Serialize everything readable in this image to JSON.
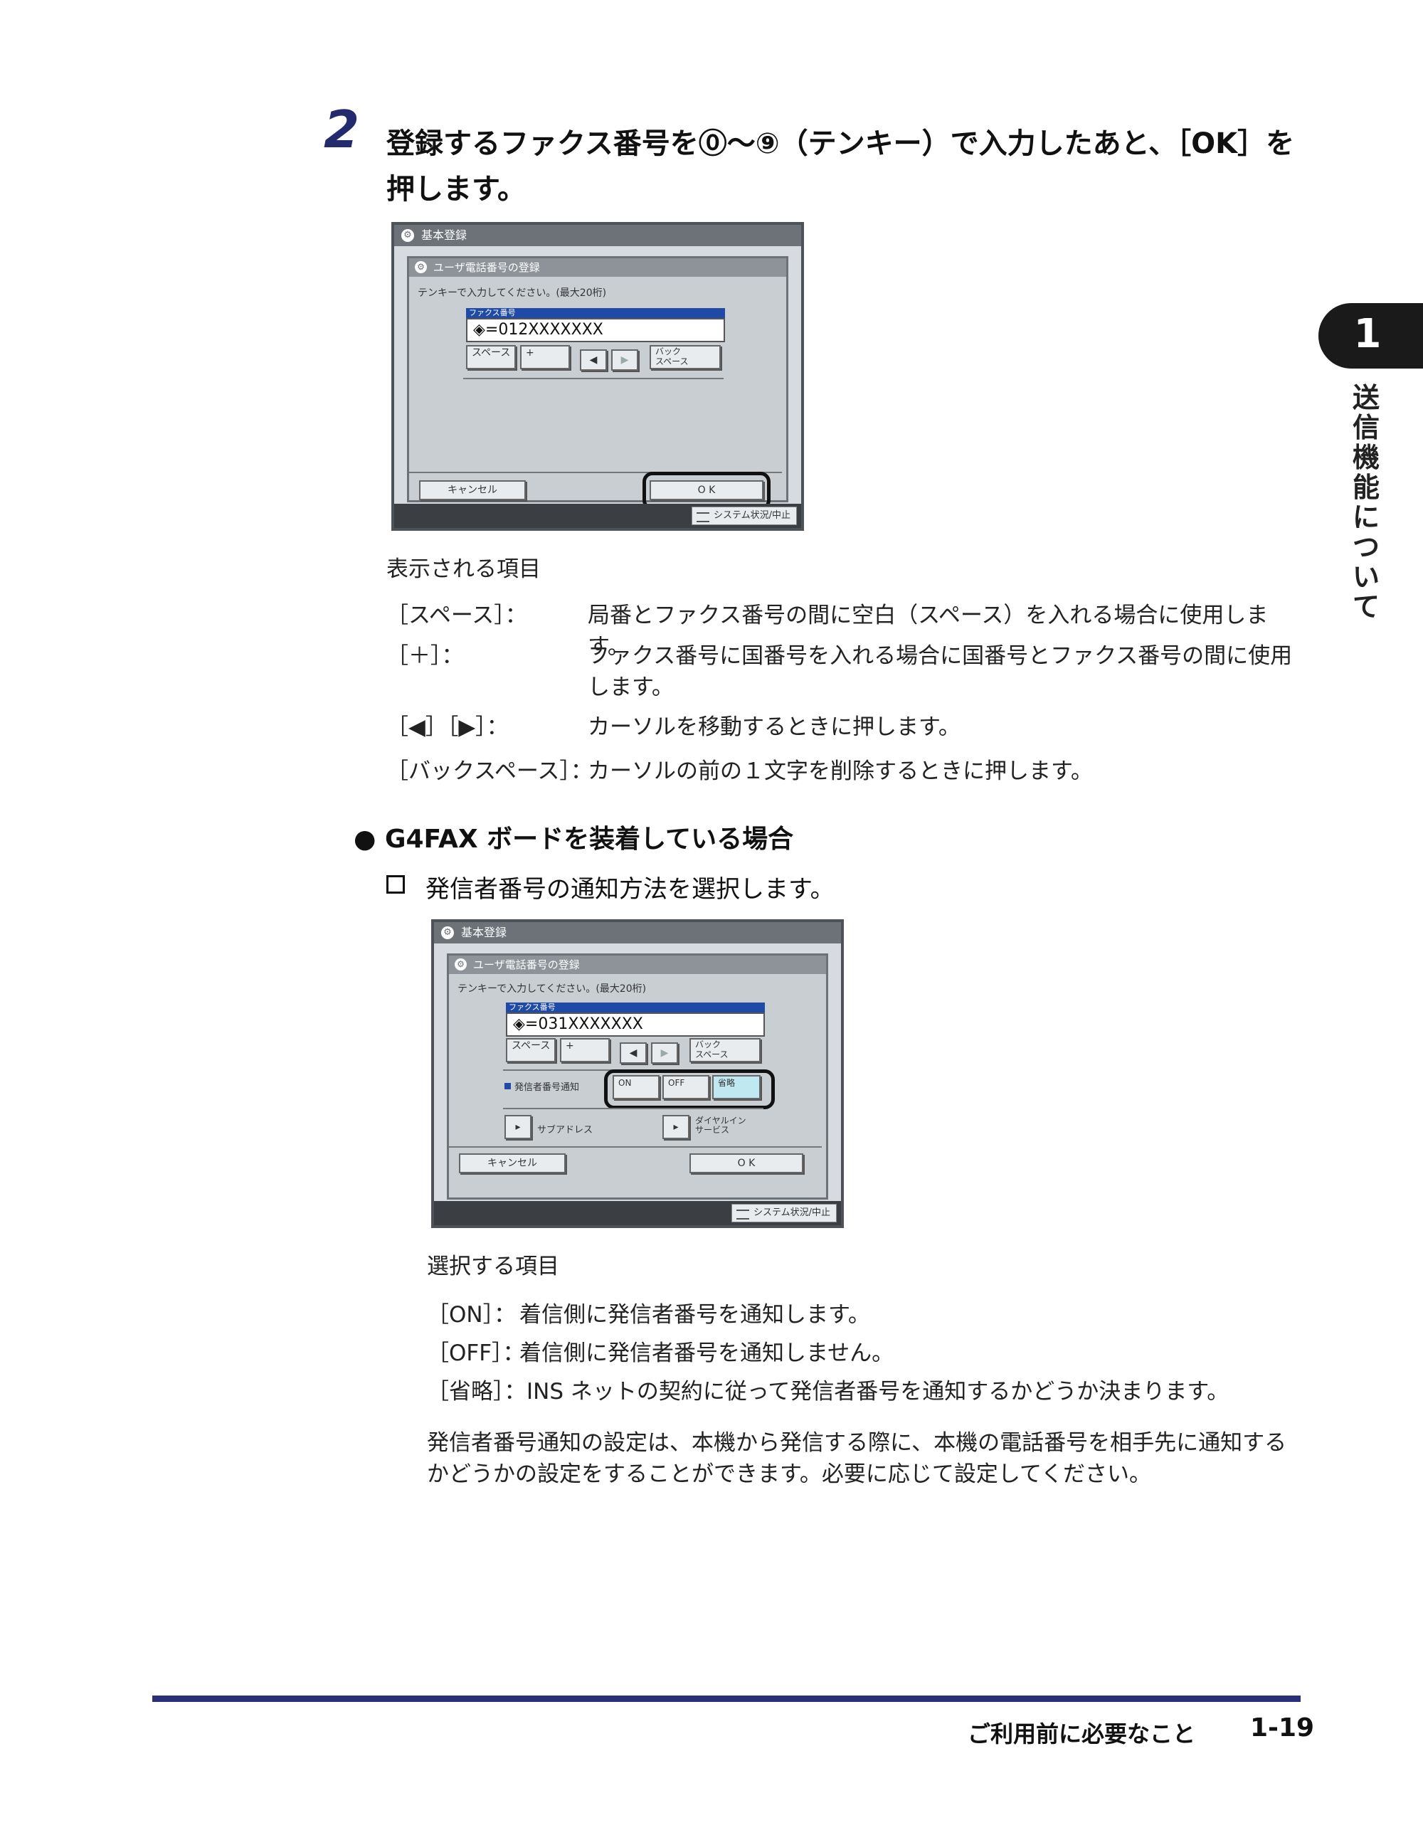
{
  "step": {
    "number": "2",
    "title": "登録するファクス番号を⓪〜⑨（テンキー）で入力したあと、［OK］を押します。"
  },
  "side_tab": {
    "chapter": "1",
    "label": "送信機能について"
  },
  "panel1": {
    "header": "基本登録",
    "sub_header": "ユーザ電話番号の登録",
    "hint": "テンキーで入力してください。(最大20桁)",
    "fax_label": "ファクス番号",
    "fax_value": "◈=012XXXXXXX",
    "buttons": {
      "space": "スペース",
      "plus": "+",
      "left": "◀",
      "right": "▶",
      "backspace": "バック\nスペース",
      "cancel": "キャンセル",
      "ok": "O K"
    },
    "status": "システム状況/中止"
  },
  "items1": {
    "heading": "表示される項目",
    "rows": [
      {
        "key": "［スペース］：",
        "desc": "局番とファクス番号の間に空白（スペース）を入れる場合に使用します。"
      },
      {
        "key": "［＋］：",
        "desc": "ファクス番号に国番号を入れる場合に国番号とファクス番号の間に使用します。"
      },
      {
        "key": "［◀］［▶］：",
        "desc": "カーソルを移動するときに押します。"
      },
      {
        "key": "［バックスペース］：",
        "desc": "カーソルの前の１文字を削除するときに押します。"
      }
    ]
  },
  "section": {
    "bullet": "● G4FAX ボードを装着している場合",
    "check": "発信者番号の通知方法を選択します。"
  },
  "panel2": {
    "header": "基本登録",
    "sub_header": "ユーザ電話番号の登録",
    "hint": "テンキーで入力してください。(最大20桁)",
    "fax_label": "ファクス番号",
    "fax_value": "◈=031XXXXXXX",
    "buttons": {
      "space": "スペース",
      "plus": "+",
      "left": "◀",
      "right": "▶",
      "backspace": "バック\nスペース",
      "notify_label": "発信者番号通知",
      "on": "ON",
      "off": "OFF",
      "omit": "省略",
      "subaddress": "サブアドレス",
      "dialin": "ダイヤルイン\nサービス",
      "cancel": "キャンセル",
      "ok": "O K"
    },
    "status": "システム状況/中止"
  },
  "items2": {
    "heading": "選択する項目",
    "rows": [
      {
        "key": "［ON］：",
        "desc": "着信側に発信者番号を通知します。"
      },
      {
        "key": "［OFF］：",
        "desc": "着信側に発信者番号を通知しません。"
      },
      {
        "key": "［省略］：",
        "desc": "INS ネットの契約に従って発信者番号を通知するかどうか決まります。"
      }
    ],
    "note": "発信者番号通知の設定は、本機から発信する際に、本機の電話番号を相手先に通知するかどうかの設定をすることができます。必要に応じて設定してください。"
  },
  "footer": {
    "title": "ご利用前に必要なこと",
    "page": "1-19"
  }
}
